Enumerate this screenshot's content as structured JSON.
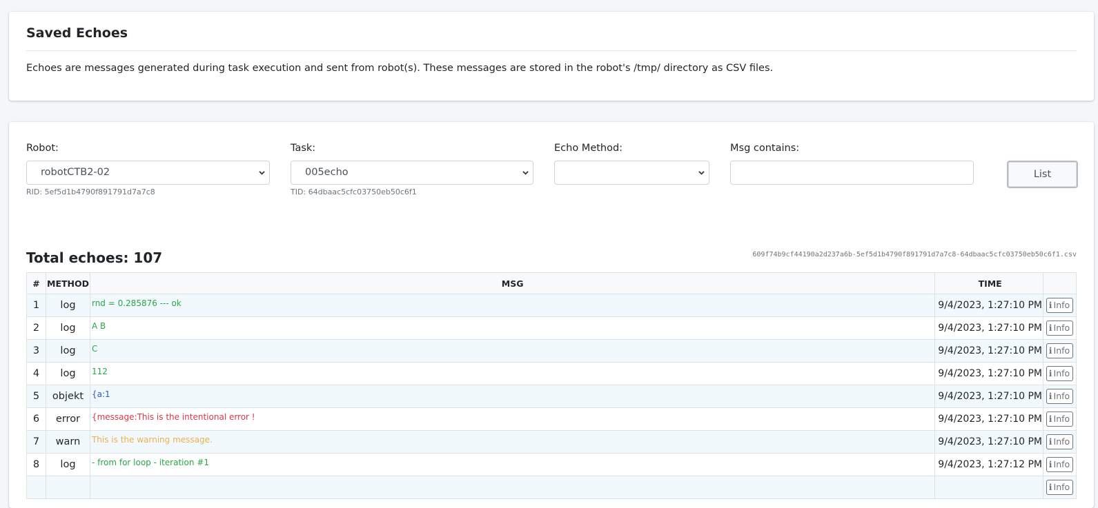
{
  "header": {
    "title": "Saved Echoes",
    "description": "Echoes are messages generated during task execution and sent from robot(s). These messages are stored in the robot's /tmp/ directory as CSV files."
  },
  "filters": {
    "robot": {
      "label": "Robot:",
      "value": "robotCTB2-02",
      "hint": "RID: 5ef5d1b4790f891791d7a7c8"
    },
    "task": {
      "label": "Task:",
      "value": "005echo",
      "hint": "TID: 64dbaac5cfc03750eb50c6f1"
    },
    "echo_method": {
      "label": "Echo Method:",
      "value": ""
    },
    "msg_contains": {
      "label": "Msg contains:",
      "value": ""
    },
    "list_button": "List"
  },
  "summary": {
    "total": "Total echoes: 107",
    "csv_file": "609f74b9cf44190a2d237a6b-5ef5d1b4790f891791d7a7c8-64dbaac5cfc03750eb50c6f1.csv"
  },
  "table": {
    "headers": {
      "num": "#",
      "method": "METHOD",
      "msg": "MSG",
      "time": "TIME"
    },
    "info_label": "Info",
    "rows": [
      {
        "num": "1",
        "method": "log",
        "msg": "rnd = 0.285876 --- ok",
        "time": "9/4/2023, 1:27:10 PM",
        "color": "#28a745"
      },
      {
        "num": "2",
        "method": "log",
        "msg": "A B",
        "time": "9/4/2023, 1:27:10 PM",
        "color": "#28a745"
      },
      {
        "num": "3",
        "method": "log",
        "msg": "C",
        "time": "9/4/2023, 1:27:10 PM",
        "color": "#28a745"
      },
      {
        "num": "4",
        "method": "log",
        "msg": "112",
        "time": "9/4/2023, 1:27:10 PM",
        "color": "#28a745"
      },
      {
        "num": "5",
        "method": "objekt",
        "msg": "{a:1",
        "time": "9/4/2023, 1:27:10 PM",
        "color": "#2b59c3"
      },
      {
        "num": "6",
        "method": "error",
        "msg": "{message:This is the intentional error !",
        "time": "9/4/2023, 1:27:10 PM",
        "color": "#dc3545"
      },
      {
        "num": "7",
        "method": "warn",
        "msg": "This is the warning message.",
        "time": "9/4/2023, 1:27:10 PM",
        "color": "#f0ad4e"
      },
      {
        "num": "8",
        "method": "log",
        "msg": "- from for loop - iteration #1",
        "time": "9/4/2023, 1:27:12 PM",
        "color": "#28a745"
      },
      {
        "num": "",
        "method": "",
        "msg": "",
        "time": "",
        "color": "#28a745"
      }
    ]
  }
}
